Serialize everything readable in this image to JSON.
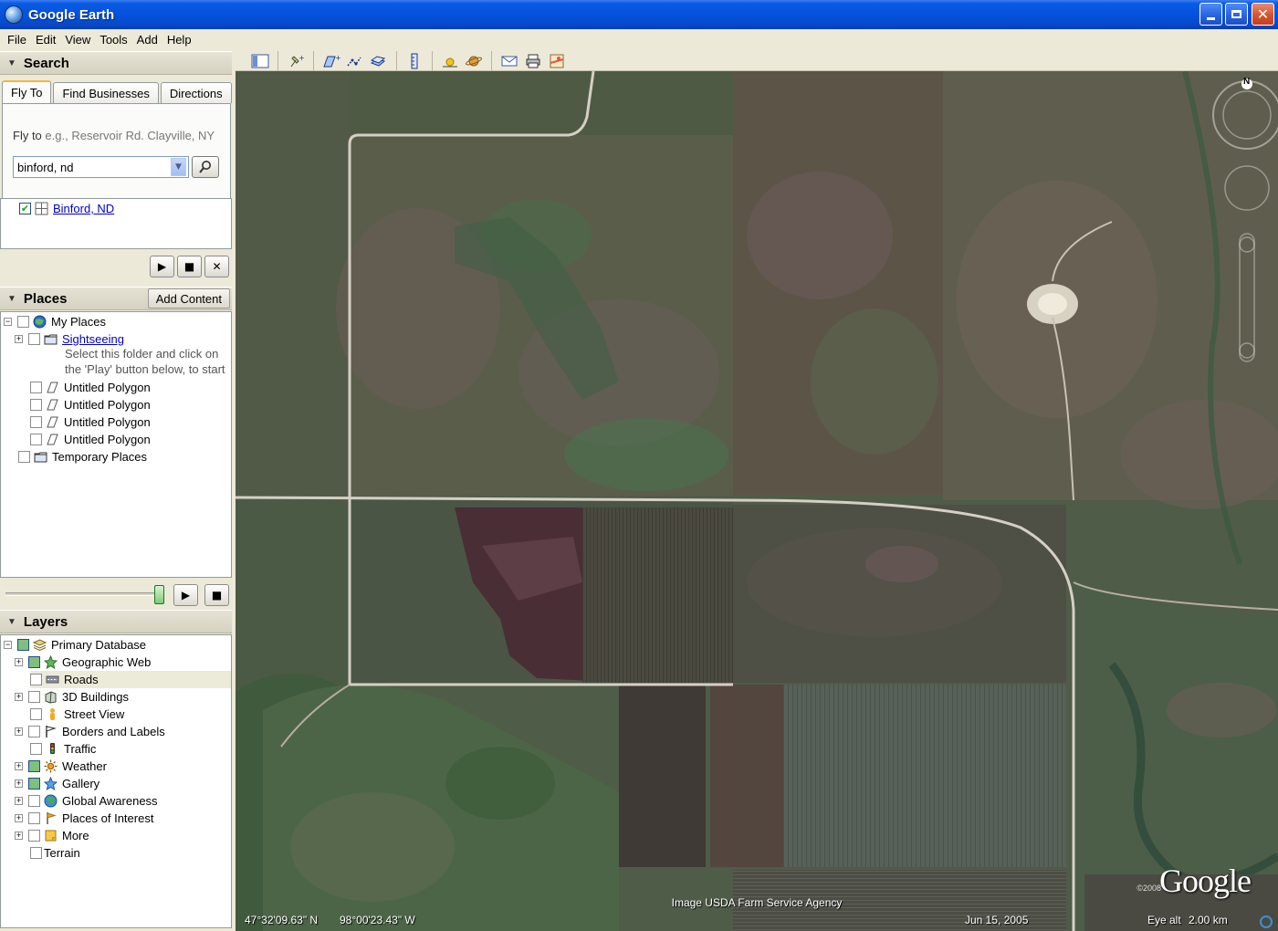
{
  "window": {
    "title": "Google Earth"
  },
  "menu": [
    "File",
    "Edit",
    "View",
    "Tools",
    "Add",
    "Help"
  ],
  "search": {
    "header": "Search",
    "tabs": [
      "Fly To",
      "Find Businesses",
      "Directions"
    ],
    "flyto_label": "Fly to",
    "flyto_hint": "e.g., Reservoir Rd. Clayville, NY",
    "query": "binford, nd",
    "result": "Binford, ND"
  },
  "places": {
    "header": "Places",
    "add_content": "Add Content",
    "my_places": "My Places",
    "sightseeing": "Sightseeing",
    "sightseeing_desc_1": "Select this folder and click on",
    "sightseeing_desc_2": "the 'Play' button below, to start",
    "polygons": [
      "Untitled Polygon",
      "Untitled Polygon",
      "Untitled Polygon",
      "Untitled Polygon"
    ],
    "temporary": "Temporary Places"
  },
  "layers": {
    "header": "Layers",
    "items": [
      {
        "label": "Primary Database",
        "checked": true
      },
      {
        "label": "Geographic Web",
        "checked": true,
        "icon": "star-icon"
      },
      {
        "label": "Roads",
        "checked": false,
        "icon": "road-icon"
      },
      {
        "label": "3D Buildings",
        "checked": false,
        "icon": "building-icon"
      },
      {
        "label": "Street View",
        "checked": false,
        "icon": "person-icon"
      },
      {
        "label": "Borders and Labels",
        "checked": false,
        "icon": "flag-icon"
      },
      {
        "label": "Traffic",
        "checked": false,
        "icon": "traffic-light-icon"
      },
      {
        "label": "Weather",
        "checked": true,
        "icon": "sun-icon"
      },
      {
        "label": "Gallery",
        "checked": true,
        "icon": "star-icon"
      },
      {
        "label": "Global Awareness",
        "checked": false,
        "icon": "globe-icon"
      },
      {
        "label": "Places of Interest",
        "checked": false,
        "icon": "flag-icon"
      },
      {
        "label": "More",
        "checked": false,
        "icon": "note-icon"
      },
      {
        "label": "Terrain",
        "checked": false
      }
    ]
  },
  "map": {
    "imagery_credit": "Image USDA Farm Service Agency",
    "lat": "47°32'09.63\" N",
    "lon": "98°00'23.43\" W",
    "date": "Jun 15, 2005",
    "eye_label": "Eye alt",
    "eye_value": "2.00 km",
    "logo": "Google",
    "copyright": "©2008",
    "north": "N"
  },
  "colors": {
    "titlebar": "#0552dc",
    "panel": "#ece9d8",
    "link": "#0000cc"
  }
}
